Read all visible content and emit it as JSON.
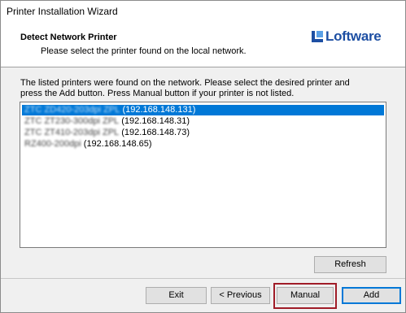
{
  "window": {
    "title": "Printer Installation Wizard"
  },
  "header": {
    "title": "Detect Network Printer",
    "subtitle": "Please select the printer found on the local network.",
    "logo_text": "Loftware",
    "accent_color": "#1d4fa3"
  },
  "instructions": {
    "line1": "The listed printers were found on the network. Please select the desired printer and",
    "line2": "press the Add button. Press Manual button if your printer is not listed."
  },
  "printers": [
    {
      "name": "ZTC ZD420-203dpi ZPL",
      "ip": "(192.168.148.131)",
      "selected": true
    },
    {
      "name": "ZTC ZT230-300dpi ZPL",
      "ip": "(192.168.148.31)",
      "selected": false
    },
    {
      "name": "ZTC ZT410-203dpi ZPL",
      "ip": "(192.168.148.73)",
      "selected": false
    },
    {
      "name": "RZ400-200dpi",
      "ip": "(192.168.148.65)",
      "selected": false
    }
  ],
  "buttons": {
    "refresh": "Refresh",
    "exit": "Exit",
    "previous": "< Previous",
    "manual": "Manual",
    "add": "Add"
  },
  "colors": {
    "selection": "#0078d7",
    "highlight_box": "#a01c28"
  }
}
